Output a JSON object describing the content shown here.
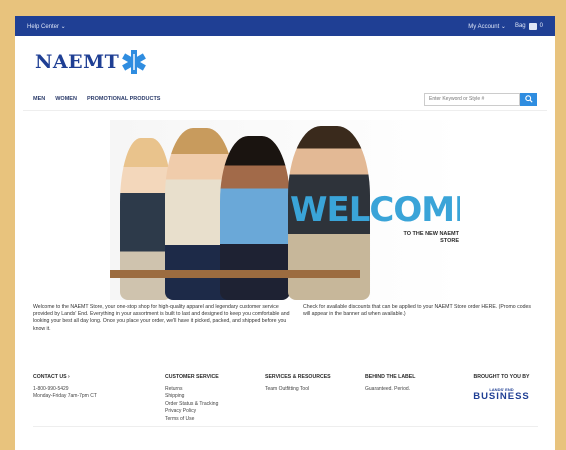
{
  "topbar": {
    "help_center": "Help Center ⌄",
    "my_account": "My Account ⌄",
    "bag_label": "Bag",
    "bag_count": "0"
  },
  "logo": {
    "text": "NAEMT"
  },
  "nav": {
    "items": [
      "MEN",
      "WOMEN",
      "PROMOTIONAL PRODUCTS"
    ]
  },
  "search": {
    "placeholder": "Enter Keyword or Style #"
  },
  "hero": {
    "headline": "WELCOME",
    "subline": "TO THE NEW NAEMT STORE"
  },
  "info": {
    "left": "Welcome to the NAEMT Store, your one-stop shop for high-quality apparel and legendary customer service provided by Lands' End. Everything in your assortment is built to last and designed to keep you comfortable and looking your best all day long. Once you place your order, we'll have it picked, packed, and shipped before you know it.",
    "right": "Check for available discounts that can be applied to your NAEMT Store order HERE. (Promo codes will appear in the banner ad when available.)"
  },
  "footer": {
    "contact": {
      "heading": "CONTACT US ›",
      "phone": "1-800-990-5429",
      "hours": "Monday-Friday 7am-7pm CT"
    },
    "customer_service": {
      "heading": "CUSTOMER SERVICE",
      "links": [
        "Returns",
        "Shipping",
        "Order Status & Tracking",
        "Privacy Policy",
        "Terms of Use"
      ]
    },
    "services": {
      "heading": "SERVICES & RESOURCES",
      "links": [
        "Team Outfitting Tool"
      ]
    },
    "behind": {
      "heading": "BEHIND THE LABEL",
      "links": [
        "Guaranteed. Period."
      ]
    },
    "brought": {
      "heading": "BROUGHT TO YOU BY",
      "brand_small": "LANDS' END",
      "brand_big": "BUSINESS"
    }
  },
  "colors": {
    "topbar": "#1f3f94",
    "accent": "#3aa4d8",
    "search_button": "#2f8de0",
    "page_border": "#e8c37d"
  }
}
